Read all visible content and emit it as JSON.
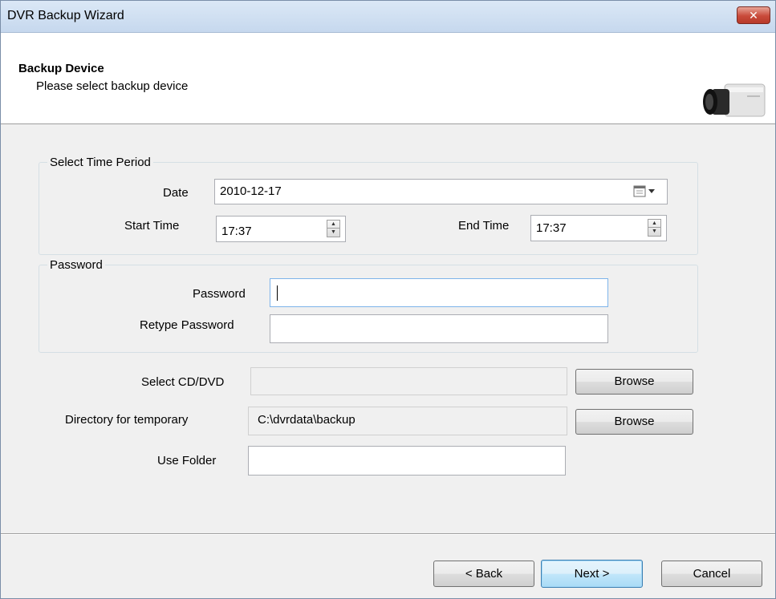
{
  "window": {
    "title": "DVR Backup Wizard",
    "close_glyph": "✕"
  },
  "header": {
    "title": "Backup Device",
    "subtitle": "Please select backup device",
    "icon": "camera-icon"
  },
  "time_period": {
    "legend": "Select Time Period",
    "date_label": "Date",
    "date_value": "2010-12-17",
    "start_label": "Start Time",
    "start_value": "17:37",
    "end_label": "End Time",
    "end_value": "17:37"
  },
  "password": {
    "legend": "Password",
    "password_label": "Password",
    "password_value": "",
    "retype_label": "Retype Password",
    "retype_value": ""
  },
  "device": {
    "cd_label": "Select CD/DVD",
    "cd_value": "",
    "temp_label": "Directory for temporary",
    "temp_value": "C:\\dvrdata\\backup",
    "folder_label": "Use Folder",
    "folder_value": "",
    "browse_label": "Browse"
  },
  "footer": {
    "back": "< Back",
    "next": "Next >",
    "cancel": "Cancel"
  },
  "colors": {
    "accent": "#3c7fb1",
    "close": "#c94a3a"
  }
}
